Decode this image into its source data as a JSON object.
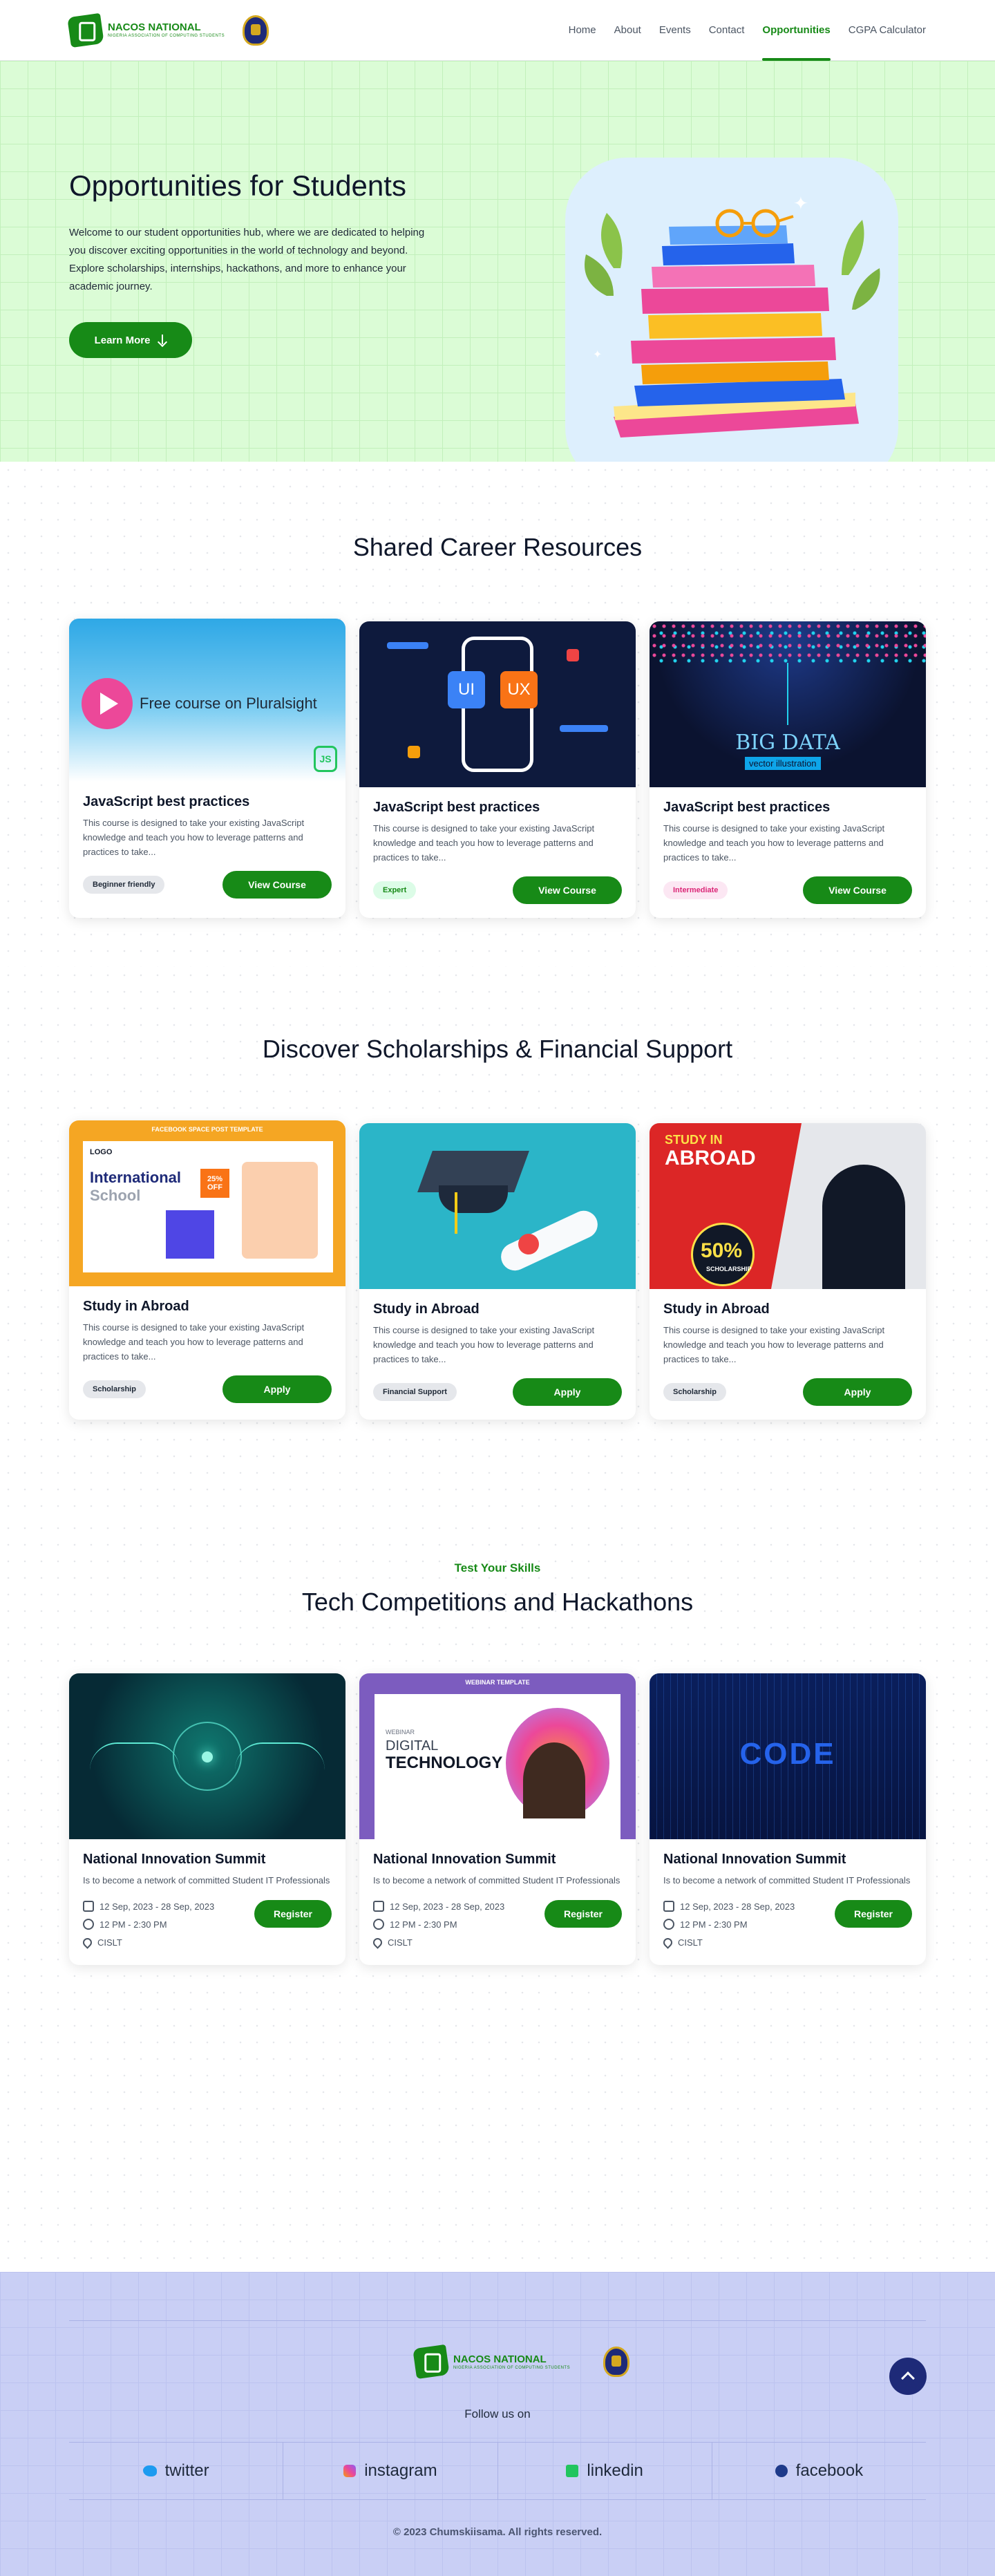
{
  "brand": {
    "name": "NACOS NATIONAL",
    "tagline": "NIGERIA ASSOCIATION OF COMPUTING STUDENTS"
  },
  "nav": [
    "Home",
    "About",
    "Events",
    "Contact",
    "Opportunities",
    "CGPA Calculator"
  ],
  "hero": {
    "title": "Opportunities for Students",
    "text": "Welcome to our student opportunities hub, where we are dedicated to helping you discover exciting opportunities in the world of technology and beyond. Explore scholarships, internships, hackathons, and more to enhance your academic journey.",
    "button": "Learn More"
  },
  "career": {
    "title": "Shared Career Resources",
    "cards": [
      {
        "title": "JavaScript best practices",
        "desc": "This course is designed to take your existing JavaScript knowledge and teach you how to leverage patterns and practices to take...",
        "badge": "Beginner friendly",
        "button": "View Course",
        "img_text": "Free course on Pluralsight"
      },
      {
        "title": "JavaScript best practices",
        "desc": "This course is designed to take your existing JavaScript knowledge and teach you how to leverage patterns and practices to take...",
        "badge": "Expert",
        "button": "View Course",
        "img_text": "UI UX"
      },
      {
        "title": "JavaScript best practices",
        "desc": "This course is designed to take your existing JavaScript knowledge and teach you how to leverage patterns and practices to take...",
        "badge": "Intermediate",
        "button": "View Course",
        "img_text": "BIG DATA",
        "img_sub": "vector illustration"
      }
    ]
  },
  "scholar": {
    "title": "Discover Scholarships & Financial Support",
    "cards": [
      {
        "title": "Study in Abroad",
        "desc": "This course is designed to take your existing JavaScript knowledge and teach you how to leverage patterns and practices to take...",
        "badge": "Scholarship",
        "button": "Apply",
        "img_top": "FACEBOOK SPACE POST TEMPLATE",
        "img_logo": "LOGO",
        "img_h1": "International",
        "img_h2": "School",
        "img_off": "25% OFF"
      },
      {
        "title": "Study in Abroad",
        "desc": "This course is designed to take your existing JavaScript knowledge and teach you how to leverage patterns and practices to take...",
        "badge": "Financial Support",
        "button": "Apply"
      },
      {
        "title": "Study in Abroad",
        "desc": "This course is designed to take your existing JavaScript knowledge and teach you how to leverage patterns and practices to take...",
        "badge": "Scholarship",
        "button": "Apply",
        "img_h1": "STUDY IN",
        "img_h2": "ABROAD",
        "img_pct": "50%",
        "img_sch": "SCHOLARSHIP"
      }
    ]
  },
  "hack": {
    "kicker": "Test Your Skills",
    "title": "Tech Competitions and Hackathons",
    "cards": [
      {
        "title": "National Innovation Summit",
        "desc": "Is to become a network of committed Student IT Professionals",
        "date": "12 Sep, 2023 - 28 Sep, 2023",
        "time": "12 PM - 2:30 PM",
        "place": "CISLT",
        "button": "Register"
      },
      {
        "title": "National Innovation Summit",
        "desc": "Is to become a network of committed Student IT Professionals",
        "date": "12 Sep, 2023 - 28 Sep, 2023",
        "time": "12 PM - 2:30 PM",
        "place": "CISLT",
        "button": "Register",
        "img_top": "WEBINAR TEMPLATE",
        "img_h1": "DIGITAL",
        "img_h2": "TECHNOLOGY",
        "img_small": "WEBINAR"
      },
      {
        "title": "National Innovation Summit",
        "desc": "Is to become a network of committed Student IT Professionals",
        "date": "12 Sep, 2023 - 28 Sep, 2023",
        "time": "12 PM - 2:30 PM",
        "place": "CISLT",
        "button": "Register",
        "img_text": "CODE"
      }
    ]
  },
  "footer": {
    "follow": "Follow us on",
    "social": [
      "twitter",
      "instagram",
      "linkedin",
      "facebook"
    ],
    "copyright": "© 2023 Chumskiisama. All rights reserved."
  },
  "colors": {
    "primary": "#178a17",
    "hero_bg": "#dbfcd6",
    "footer_bg": "#c9cff5",
    "navy": "#1e2a78"
  },
  "icons": [
    "logo-icon",
    "crest-icon",
    "arrow-down-icon",
    "calendar-icon",
    "clock-icon",
    "location-icon",
    "twitter-icon",
    "instagram-icon",
    "linkedin-icon",
    "facebook-icon",
    "arrow-up-icon",
    "play-icon"
  ]
}
